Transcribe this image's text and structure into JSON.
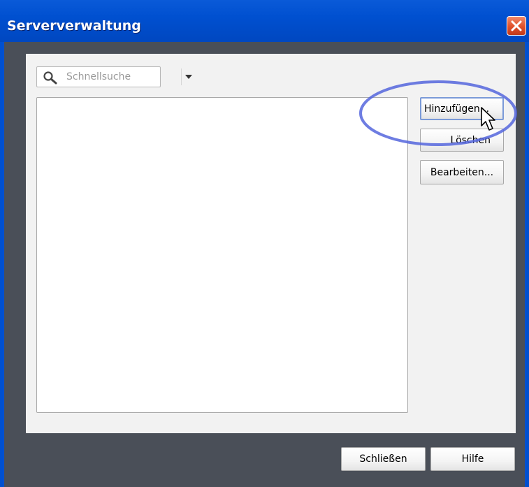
{
  "window": {
    "title": "Serververwaltung"
  },
  "search": {
    "placeholder": "Schnellsuche"
  },
  "side_buttons": {
    "add_label": "Hinzufügen...",
    "delete_label": "Löschen",
    "edit_label": "Bearbeiten..."
  },
  "footer_buttons": {
    "close_label": "Schließen",
    "help_label": "Hilfe"
  },
  "colors": {
    "titlebar": "#0050d0",
    "highlight_ellipse": "#5566dd",
    "close_button": "#e0502a"
  },
  "icons": [
    "search-icon",
    "chevron-down-icon",
    "close-icon",
    "mouse-pointer-icon"
  ]
}
